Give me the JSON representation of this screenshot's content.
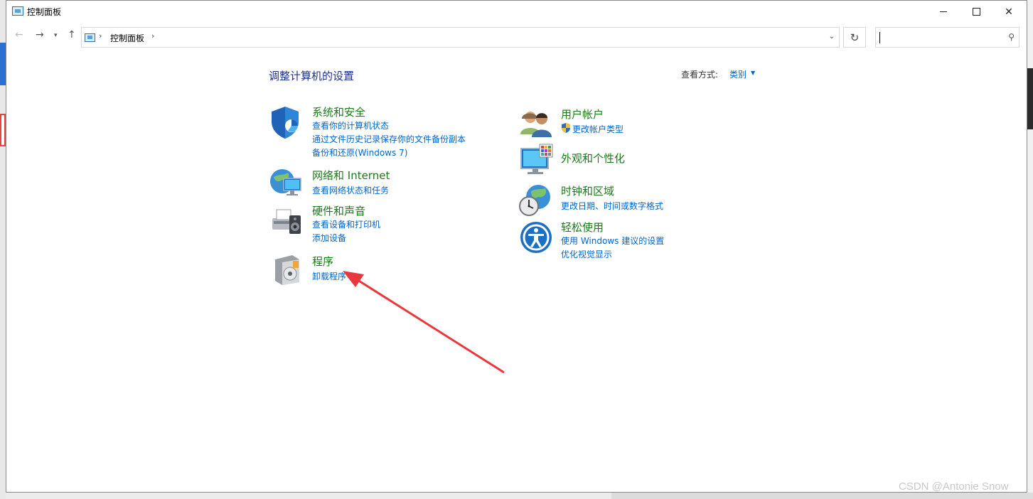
{
  "window": {
    "title": "控制面板"
  },
  "address": {
    "crumb": "控制面板",
    "separator": "›"
  },
  "search": {
    "placeholder": ""
  },
  "main": {
    "heading": "调整计算机的设置",
    "view_by_label": "查看方式:",
    "view_by_value": "类别"
  },
  "categories": {
    "security": {
      "title": "系统和安全",
      "links": [
        "查看你的计算机状态",
        "通过文件历史记录保存你的文件备份副本",
        "备份和还原(Windows 7)"
      ]
    },
    "network": {
      "title": "网络和 Internet",
      "links": [
        "查看网络状态和任务"
      ]
    },
    "hardware": {
      "title": "硬件和声音",
      "links": [
        "查看设备和打印机",
        "添加设备"
      ]
    },
    "programs": {
      "title": "程序",
      "links": [
        "卸载程序"
      ]
    },
    "accounts": {
      "title": "用户帐户",
      "links": [
        "更改帐户类型"
      ]
    },
    "appearance": {
      "title": "外观和个性化",
      "links": []
    },
    "clock": {
      "title": "时钟和区域",
      "links": [
        "更改日期、时间或数字格式"
      ]
    },
    "ease": {
      "title": "轻松使用",
      "links": [
        "使用 Windows 建议的设置",
        "优化视觉显示"
      ]
    }
  },
  "annotation": {
    "color": "#e8383d",
    "points_to": "卸载程序"
  },
  "watermark": "CSDN @Antonie Snow",
  "colors": {
    "link": "#0066cc",
    "category_title": "#1a7a1a",
    "heading": "#1e3287"
  }
}
